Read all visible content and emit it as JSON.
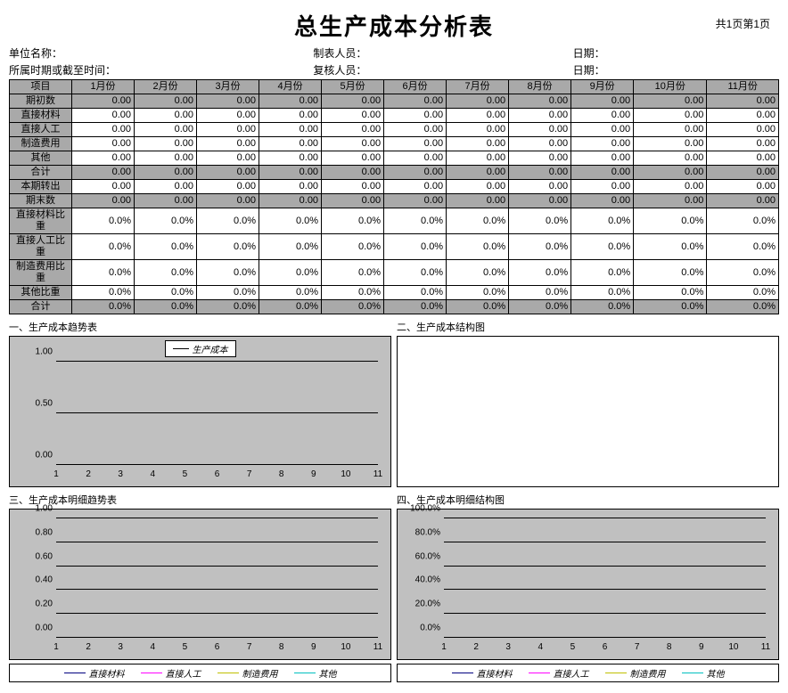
{
  "title": "总生产成本分析表",
  "page_label": "共1页第1页",
  "meta": {
    "row1_left": "单位名称：",
    "row1_mid": "制表人员：",
    "row1_right": "日期：",
    "row2_left": "所属时期或截至时间：",
    "row2_mid": "复核人员：",
    "row2_right": "日期："
  },
  "table": {
    "col_header": [
      "项目",
      "1月份",
      "2月份",
      "3月份",
      "4月份",
      "5月份",
      "6月份",
      "7月份",
      "8月份",
      "9月份",
      "10月份",
      "11月份"
    ],
    "rows": [
      {
        "label": "期初数",
        "shaded": true,
        "vals": [
          "0.00",
          "0.00",
          "0.00",
          "0.00",
          "0.00",
          "0.00",
          "0.00",
          "0.00",
          "0.00",
          "0.00",
          "0.00"
        ]
      },
      {
        "label": "直接材料",
        "shaded": false,
        "vals": [
          "0.00",
          "0.00",
          "0.00",
          "0.00",
          "0.00",
          "0.00",
          "0.00",
          "0.00",
          "0.00",
          "0.00",
          "0.00"
        ]
      },
      {
        "label": "直接人工",
        "shaded": false,
        "vals": [
          "0.00",
          "0.00",
          "0.00",
          "0.00",
          "0.00",
          "0.00",
          "0.00",
          "0.00",
          "0.00",
          "0.00",
          "0.00"
        ]
      },
      {
        "label": "制造费用",
        "shaded": false,
        "vals": [
          "0.00",
          "0.00",
          "0.00",
          "0.00",
          "0.00",
          "0.00",
          "0.00",
          "0.00",
          "0.00",
          "0.00",
          "0.00"
        ]
      },
      {
        "label": "其他",
        "shaded": false,
        "vals": [
          "0.00",
          "0.00",
          "0.00",
          "0.00",
          "0.00",
          "0.00",
          "0.00",
          "0.00",
          "0.00",
          "0.00",
          "0.00"
        ]
      },
      {
        "label": "合计",
        "shaded": true,
        "vals": [
          "0.00",
          "0.00",
          "0.00",
          "0.00",
          "0.00",
          "0.00",
          "0.00",
          "0.00",
          "0.00",
          "0.00",
          "0.00"
        ]
      },
      {
        "label": "本期转出",
        "shaded": false,
        "vals": [
          "0.00",
          "0.00",
          "0.00",
          "0.00",
          "0.00",
          "0.00",
          "0.00",
          "0.00",
          "0.00",
          "0.00",
          "0.00"
        ]
      },
      {
        "label": "期末数",
        "shaded": true,
        "vals": [
          "0.00",
          "0.00",
          "0.00",
          "0.00",
          "0.00",
          "0.00",
          "0.00",
          "0.00",
          "0.00",
          "0.00",
          "0.00"
        ]
      },
      {
        "label": "直接材料比重",
        "shaded": false,
        "vals": [
          "0.0%",
          "0.0%",
          "0.0%",
          "0.0%",
          "0.0%",
          "0.0%",
          "0.0%",
          "0.0%",
          "0.0%",
          "0.0%",
          "0.0%"
        ]
      },
      {
        "label": "直接人工比重",
        "shaded": false,
        "vals": [
          "0.0%",
          "0.0%",
          "0.0%",
          "0.0%",
          "0.0%",
          "0.0%",
          "0.0%",
          "0.0%",
          "0.0%",
          "0.0%",
          "0.0%"
        ]
      },
      {
        "label": "制造费用比重",
        "shaded": false,
        "vals": [
          "0.0%",
          "0.0%",
          "0.0%",
          "0.0%",
          "0.0%",
          "0.0%",
          "0.0%",
          "0.0%",
          "0.0%",
          "0.0%",
          "0.0%"
        ]
      },
      {
        "label": "其他比重",
        "shaded": false,
        "vals": [
          "0.0%",
          "0.0%",
          "0.0%",
          "0.0%",
          "0.0%",
          "0.0%",
          "0.0%",
          "0.0%",
          "0.0%",
          "0.0%",
          "0.0%"
        ]
      },
      {
        "label": "合计",
        "shaded": true,
        "vals": [
          "0.0%",
          "0.0%",
          "0.0%",
          "0.0%",
          "0.0%",
          "0.0%",
          "0.0%",
          "0.0%",
          "0.0%",
          "0.0%",
          "0.0%"
        ]
      }
    ]
  },
  "charts": {
    "c1": {
      "title": "一、生产成本趋势表",
      "legend": "生产成本"
    },
    "c2": {
      "title": "二、生产成本结构图"
    },
    "c3": {
      "title": "三、生产成本明细趋势表"
    },
    "c4": {
      "title": "四、生产成本明细结构图"
    }
  },
  "legend_items": {
    "l1": "直接材料",
    "l2": "直接人工",
    "l3": "制造费用",
    "l4": "其他"
  },
  "chart_data": [
    {
      "type": "line",
      "title": "生产成本趋势表",
      "x": [
        1,
        2,
        3,
        4,
        5,
        6,
        7,
        8,
        9,
        10,
        11
      ],
      "series": [
        {
          "name": "生产成本",
          "values": [
            0,
            0,
            0,
            0,
            0,
            0,
            0,
            0,
            0,
            0,
            0
          ]
        }
      ],
      "yticks": [
        "0.00",
        "0.50",
        "1.00"
      ],
      "ylim": [
        0,
        1
      ]
    },
    {
      "type": "bar",
      "title": "生产成本结构图",
      "categories": [],
      "values": []
    },
    {
      "type": "line",
      "title": "生产成本明细趋势表",
      "x": [
        1,
        2,
        3,
        4,
        5,
        6,
        7,
        8,
        9,
        10,
        11
      ],
      "series": [
        {
          "name": "直接材料",
          "values": [
            0,
            0,
            0,
            0,
            0,
            0,
            0,
            0,
            0,
            0,
            0
          ]
        },
        {
          "name": "直接人工",
          "values": [
            0,
            0,
            0,
            0,
            0,
            0,
            0,
            0,
            0,
            0,
            0
          ]
        },
        {
          "name": "制造费用",
          "values": [
            0,
            0,
            0,
            0,
            0,
            0,
            0,
            0,
            0,
            0,
            0
          ]
        },
        {
          "name": "其他",
          "values": [
            0,
            0,
            0,
            0,
            0,
            0,
            0,
            0,
            0,
            0,
            0
          ]
        }
      ],
      "yticks": [
        "0.00",
        "0.20",
        "0.40",
        "0.60",
        "0.80",
        "1.00"
      ],
      "ylim": [
        0,
        1
      ]
    },
    {
      "type": "line",
      "title": "生产成本明细结构图",
      "x": [
        1,
        2,
        3,
        4,
        5,
        6,
        7,
        8,
        9,
        10,
        11
      ],
      "series": [
        {
          "name": "直接材料",
          "values": [
            0,
            0,
            0,
            0,
            0,
            0,
            0,
            0,
            0,
            0,
            0
          ]
        },
        {
          "name": "直接人工",
          "values": [
            0,
            0,
            0,
            0,
            0,
            0,
            0,
            0,
            0,
            0,
            0
          ]
        },
        {
          "name": "制造费用",
          "values": [
            0,
            0,
            0,
            0,
            0,
            0,
            0,
            0,
            0,
            0,
            0
          ]
        },
        {
          "name": "其他",
          "values": [
            0,
            0,
            0,
            0,
            0,
            0,
            0,
            0,
            0,
            0,
            0
          ]
        }
      ],
      "yticks": [
        "0.0%",
        "20.0%",
        "40.0%",
        "60.0%",
        "80.0%",
        "100.0%"
      ],
      "ylim": [
        0,
        100
      ]
    }
  ]
}
